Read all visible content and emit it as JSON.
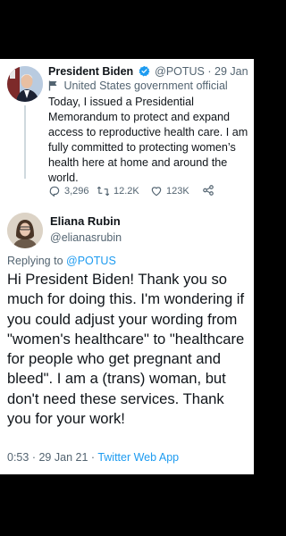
{
  "parent_tweet": {
    "author_name": "President Biden",
    "author_handle": "@POTUS",
    "separator": "·",
    "date": "29 Jan",
    "label": "United States government official",
    "text": "Today, I issued a Presidential Memorandum to protect and expand access to reproductive health care. I am fully committed to protecting women’s health here at home and around the world.",
    "replies": "3,296",
    "retweets": "12.2K",
    "likes": "123K",
    "icons": [
      "verified-badge-icon",
      "flag-icon",
      "reply-icon",
      "retweet-icon",
      "like-icon",
      "share-icon"
    ]
  },
  "reply_tweet": {
    "author_name": "Eliana Rubin",
    "author_handle": "@elianasrubin",
    "replying_prefix": "Replying to",
    "replying_to": "@POTUS",
    "text": "Hi President Biden! Thank you so much for doing this. I'm wondering if you could adjust your wording from \"women's healthcare\" to \"healthcare for people who get pregnant and bleed\". I am a (trans) woman, but don't need these services. Thank you for your work!",
    "time": "0:53",
    "date": "29 Jan 21",
    "separator": "·",
    "client": "Twitter Web App"
  },
  "colors": {
    "background": "#000000",
    "card": "#ffffff",
    "text": "#0f1419",
    "secondary": "#536471",
    "link": "#1d9bf0"
  }
}
